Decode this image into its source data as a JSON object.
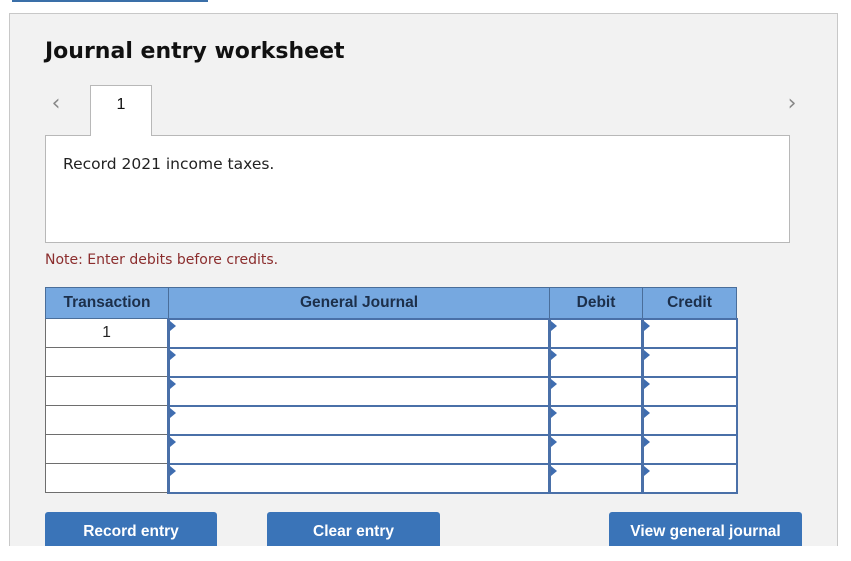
{
  "worksheet": {
    "title": "Journal entry worksheet",
    "nav": {
      "prev_icon": "chevron-left-icon",
      "next_icon": "chevron-right-icon"
    },
    "tabs": [
      {
        "label": "1",
        "active": true
      }
    ],
    "description": "Record 2021 income taxes.",
    "note": "Note: Enter debits before credits."
  },
  "table": {
    "headers": [
      "Transaction",
      "General Journal",
      "Debit",
      "Credit"
    ],
    "rows": [
      {
        "transaction": "1",
        "general_journal": "",
        "debit": "",
        "credit": ""
      },
      {
        "transaction": "",
        "general_journal": "",
        "debit": "",
        "credit": ""
      },
      {
        "transaction": "",
        "general_journal": "",
        "debit": "",
        "credit": ""
      },
      {
        "transaction": "",
        "general_journal": "",
        "debit": "",
        "credit": ""
      },
      {
        "transaction": "",
        "general_journal": "",
        "debit": "",
        "credit": ""
      },
      {
        "transaction": "",
        "general_journal": "",
        "debit": "",
        "credit": ""
      }
    ]
  },
  "buttons": {
    "record": "Record entry",
    "clear": "Clear entry",
    "view": "View general journal"
  },
  "colors": {
    "header_bg": "#76a8e0",
    "button_bg": "#3a74b8",
    "note_color": "#8b2d2d",
    "input_border": "#4a70a8"
  }
}
